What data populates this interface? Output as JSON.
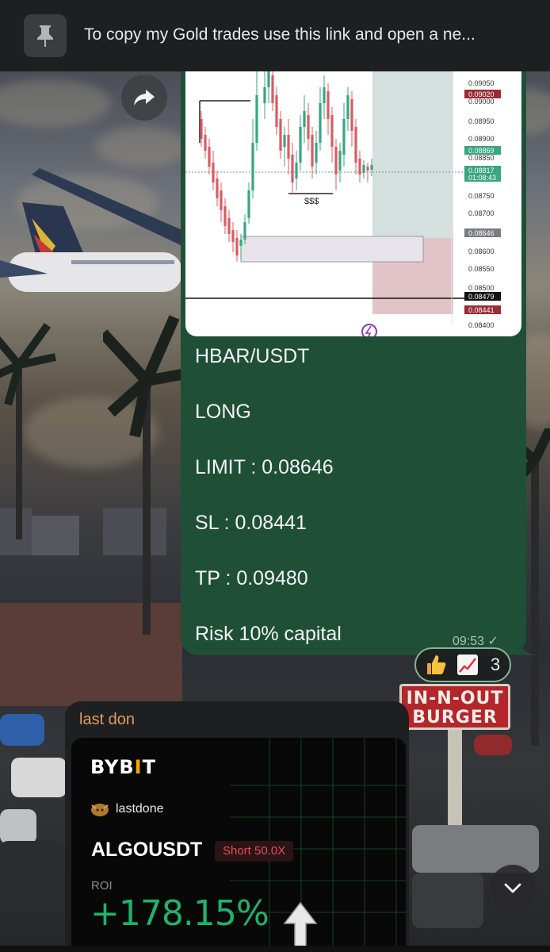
{
  "pinned": {
    "text": "To copy my Gold trades use this link and open a ne..."
  },
  "signal_message": {
    "chart": {
      "price_labels": [
        "0.09050",
        "0.09020",
        "0.09000",
        "0.08950",
        "0.08900",
        "0.08869",
        "0.08850",
        "0.08817",
        "01:08:43",
        "0.08750",
        "0.08700",
        "0.08646",
        "0.08600",
        "0.08550",
        "0.08500",
        "0.08479",
        "0.08441",
        "0.08400"
      ],
      "annotation": "$$$"
    },
    "lines": [
      "HBAR/USDT",
      "LONG",
      "LIMIT : 0.08646",
      "SL : 0.08441",
      "TP : 0.09480",
      "Risk 10% capital"
    ],
    "time": "09:53",
    "read_mark": "✓",
    "reactions": {
      "count": "3"
    }
  },
  "second_message": {
    "sender": "last don",
    "card": {
      "logo_left": "BYB",
      "logo_accent": "I",
      "logo_right": "T",
      "username": "lastdone",
      "pair": "ALGOUSDT",
      "tag": "Short 50.0X",
      "roi_label": "ROI",
      "roi_value": "+178.15%"
    }
  },
  "background_sign": {
    "line1": "IN-N-OUT",
    "line2": "BURGER"
  },
  "colors": {
    "bubble": "#1f4f37",
    "accent_green": "#20b26c",
    "short_red": "#e94d57",
    "sender": "#e39a68"
  }
}
